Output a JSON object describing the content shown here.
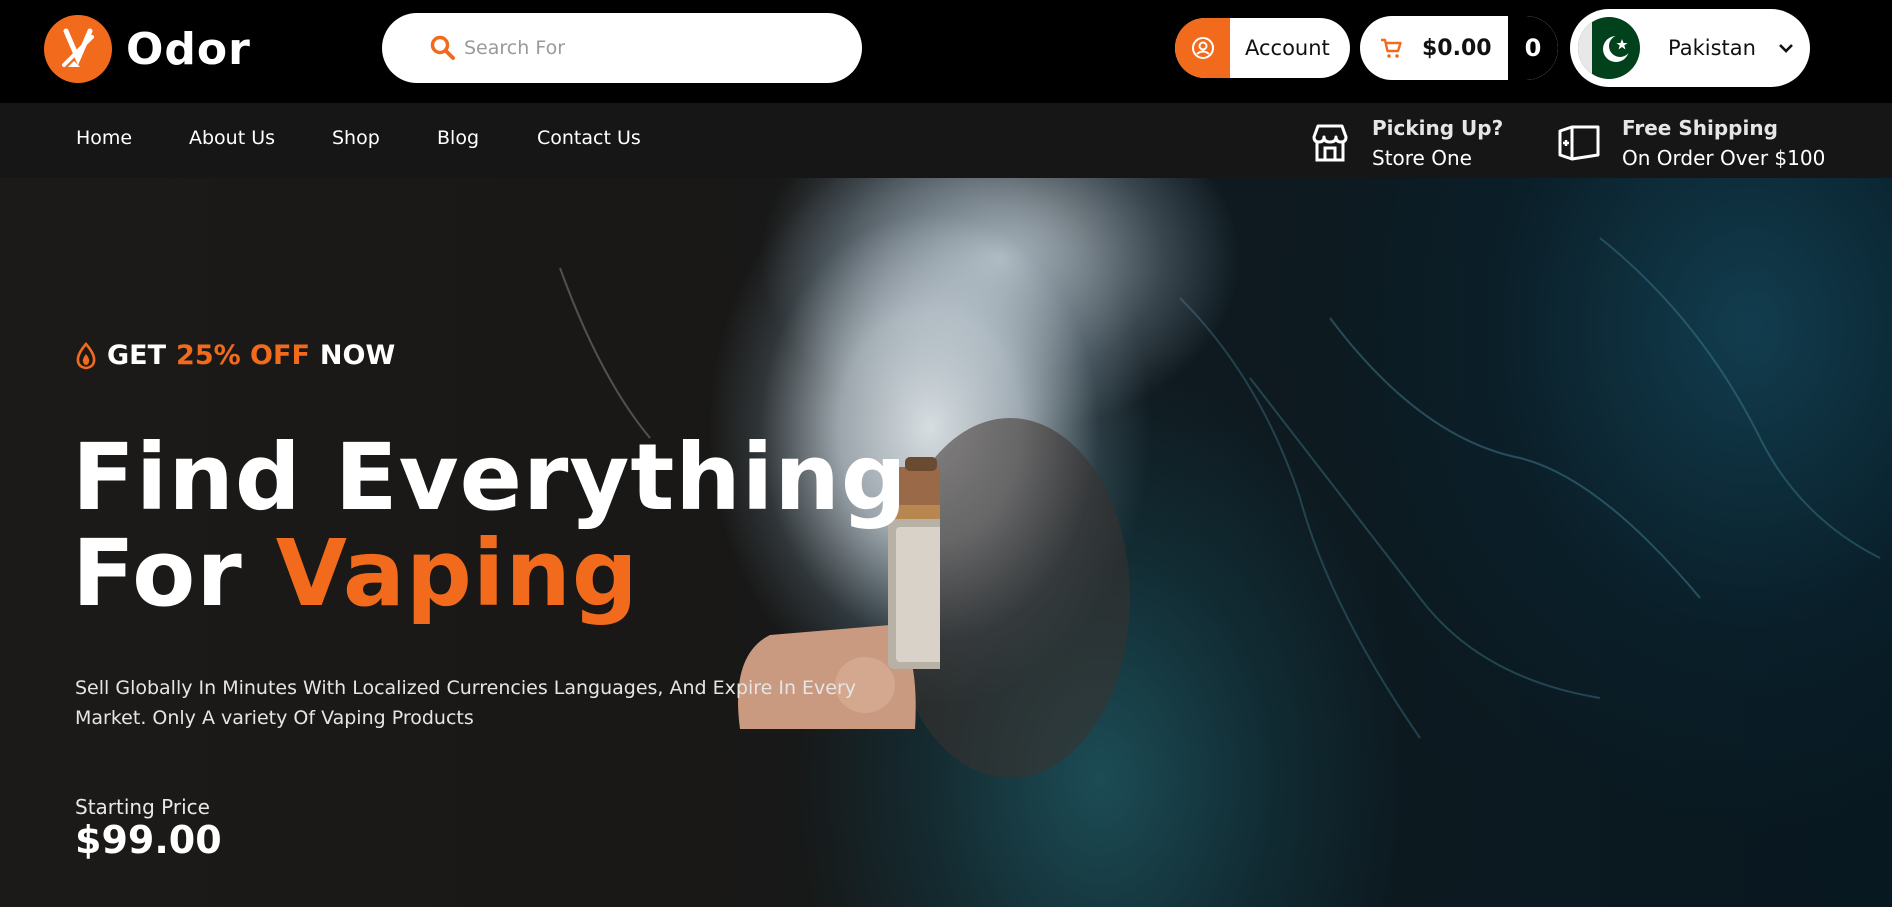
{
  "brand": {
    "name": "Odor"
  },
  "search": {
    "placeholder": "Search For"
  },
  "account": {
    "label": "Account"
  },
  "cart": {
    "total": "$0.00",
    "count": "0"
  },
  "country": {
    "name": "Pakistan"
  },
  "nav": {
    "items": [
      {
        "label": "Home"
      },
      {
        "label": "About Us"
      },
      {
        "label": "Shop"
      },
      {
        "label": "Blog"
      },
      {
        "label": "Contact Us"
      }
    ],
    "pickup": {
      "title": "Picking Up?",
      "subtitle": "Store One"
    },
    "shipping": {
      "title": "Free Shipping",
      "subtitle": "On Order Over $100"
    }
  },
  "hero": {
    "badge": {
      "part1": "GET",
      "part2": "25% OFF",
      "part3": "NOW"
    },
    "headline_line1": "Find Everything",
    "headline_line2_prefix": "For",
    "headline_line2_accent": "Vaping",
    "description": "Sell Globally In Minutes With Localized Currencies Languages, And Expire In Every Market. Only A variety Of Vaping Products",
    "starting_price_label": "Starting Price",
    "starting_price": "$99.00"
  },
  "colors": {
    "accent": "#f26b1d",
    "topbar": "#000000",
    "navbar": "#161616"
  },
  "icons": [
    "logo-icon",
    "search-icon",
    "user-icon",
    "cart-icon",
    "pakistan-flag-icon",
    "chevron-down-icon",
    "store-icon",
    "shipping-box-icon",
    "flame-icon"
  ]
}
